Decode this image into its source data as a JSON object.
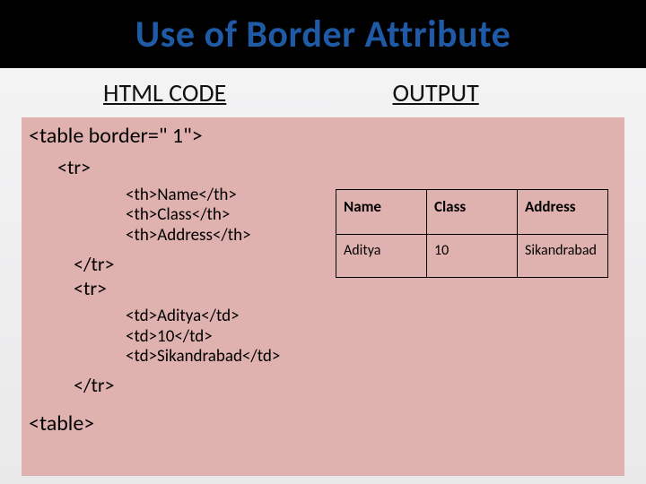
{
  "title": "Use of Border Attribute",
  "headings": {
    "left": "HTML CODE",
    "right": "OUTPUT"
  },
  "code": {
    "l1": "<table border=\" 1\">",
    "l2": "<tr>",
    "l3": "<th>Name</th>",
    "l4": "<th>Class</th>",
    "l5": "<th>Address</th>",
    "l6": "</tr>",
    "l7": "<tr>",
    "l8": "<td>Aditya</td>",
    "l9": "<td>10</td>",
    "l10": "<td>Sikandrabad</td>",
    "l11": "</tr>",
    "l12": "<table>"
  },
  "output": {
    "headers": {
      "c1": "Name",
      "c2": "Class",
      "c3": "Address"
    },
    "row1": {
      "c1": "Aditya",
      "c2": "10",
      "c3": "Sikandrabad"
    }
  }
}
